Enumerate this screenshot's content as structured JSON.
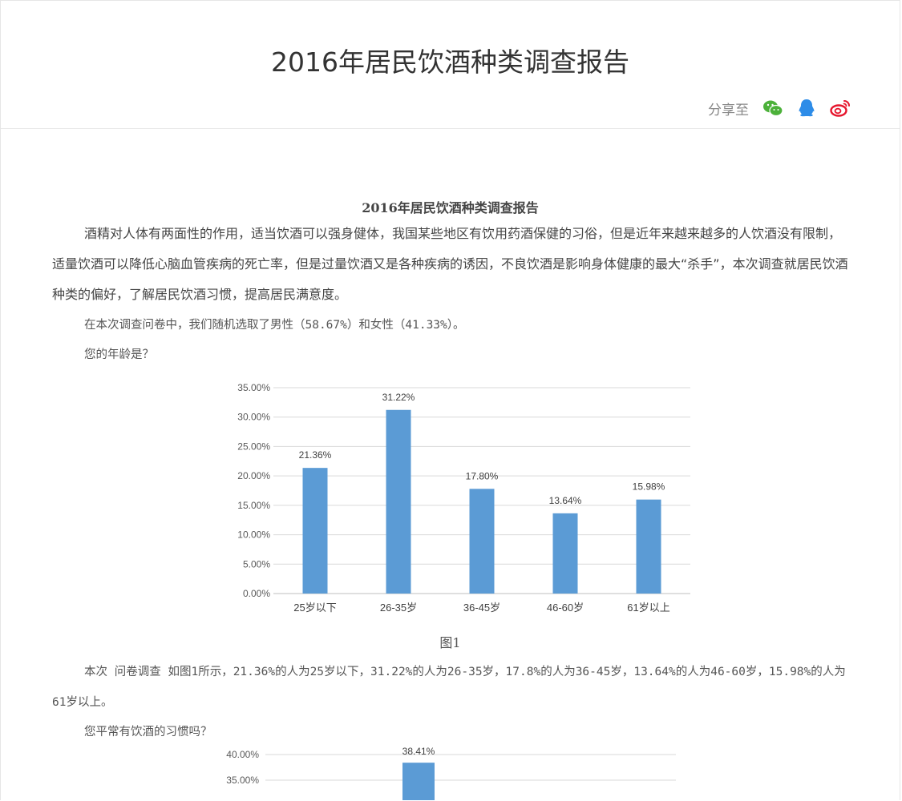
{
  "header": {
    "title": "2016年居民饮酒种类调查报告",
    "share_label": "分享至",
    "share_icons": [
      "wechat-icon",
      "qq-icon",
      "weibo-icon"
    ],
    "colors": {
      "wechat": "#4cb13a",
      "qq": "#2d8ce8",
      "weibo": "#e6162d"
    }
  },
  "article": {
    "title": "2016年居民饮酒种类调查报告",
    "intro": "酒精对人体有两面性的作用，适当饮酒可以强身健体，我国某些地区有饮用药酒保健的习俗，但是近年来越来越多的人饮酒没有限制，适量饮酒可以降低心脑血管疾病的死亡率，但是过量饮酒又是各种疾病的诱因，不良饮酒是影响身体健康的最大“杀手”，本次调查就居民饮酒种类的偏好，了解居民饮酒习惯，提高居民满意度。",
    "gender": "在本次调查问卷中，我们随机选取了男性（58.67%）和女性（41.33%）。",
    "q1": "您的年龄是？",
    "fig1_caption": "图1",
    "fig1_text": "本次 问卷调查 如图1所示，21.36%的人为25岁以下，31.22%的人为26-35岁，17.8%的人为36-45岁，13.64%的人为46-60岁，15.98%的人为61岁以上。",
    "q2": "您平常有饮酒的习惯吗？"
  },
  "chart_data": [
    {
      "type": "bar",
      "categories": [
        "25岁以下",
        "26-35岁",
        "36-45岁",
        "46-60岁",
        "61岁以上"
      ],
      "values": [
        21.36,
        31.22,
        17.8,
        13.64,
        15.98
      ],
      "value_labels": [
        "21.36%",
        "31.22%",
        "17.80%",
        "13.64%",
        "15.98%"
      ],
      "y_ticks": [
        "0.00%",
        "5.00%",
        "10.00%",
        "15.00%",
        "20.00%",
        "25.00%",
        "30.00%",
        "35.00%"
      ],
      "ylim": [
        0,
        35
      ],
      "grid": true,
      "color": "#5b9bd5"
    },
    {
      "type": "bar",
      "values_visible": [
        38.41
      ],
      "value_labels": [
        "38.41%"
      ],
      "y_ticks_visible": [
        "40.00%",
        "35.00%"
      ],
      "color": "#5b9bd5"
    }
  ]
}
